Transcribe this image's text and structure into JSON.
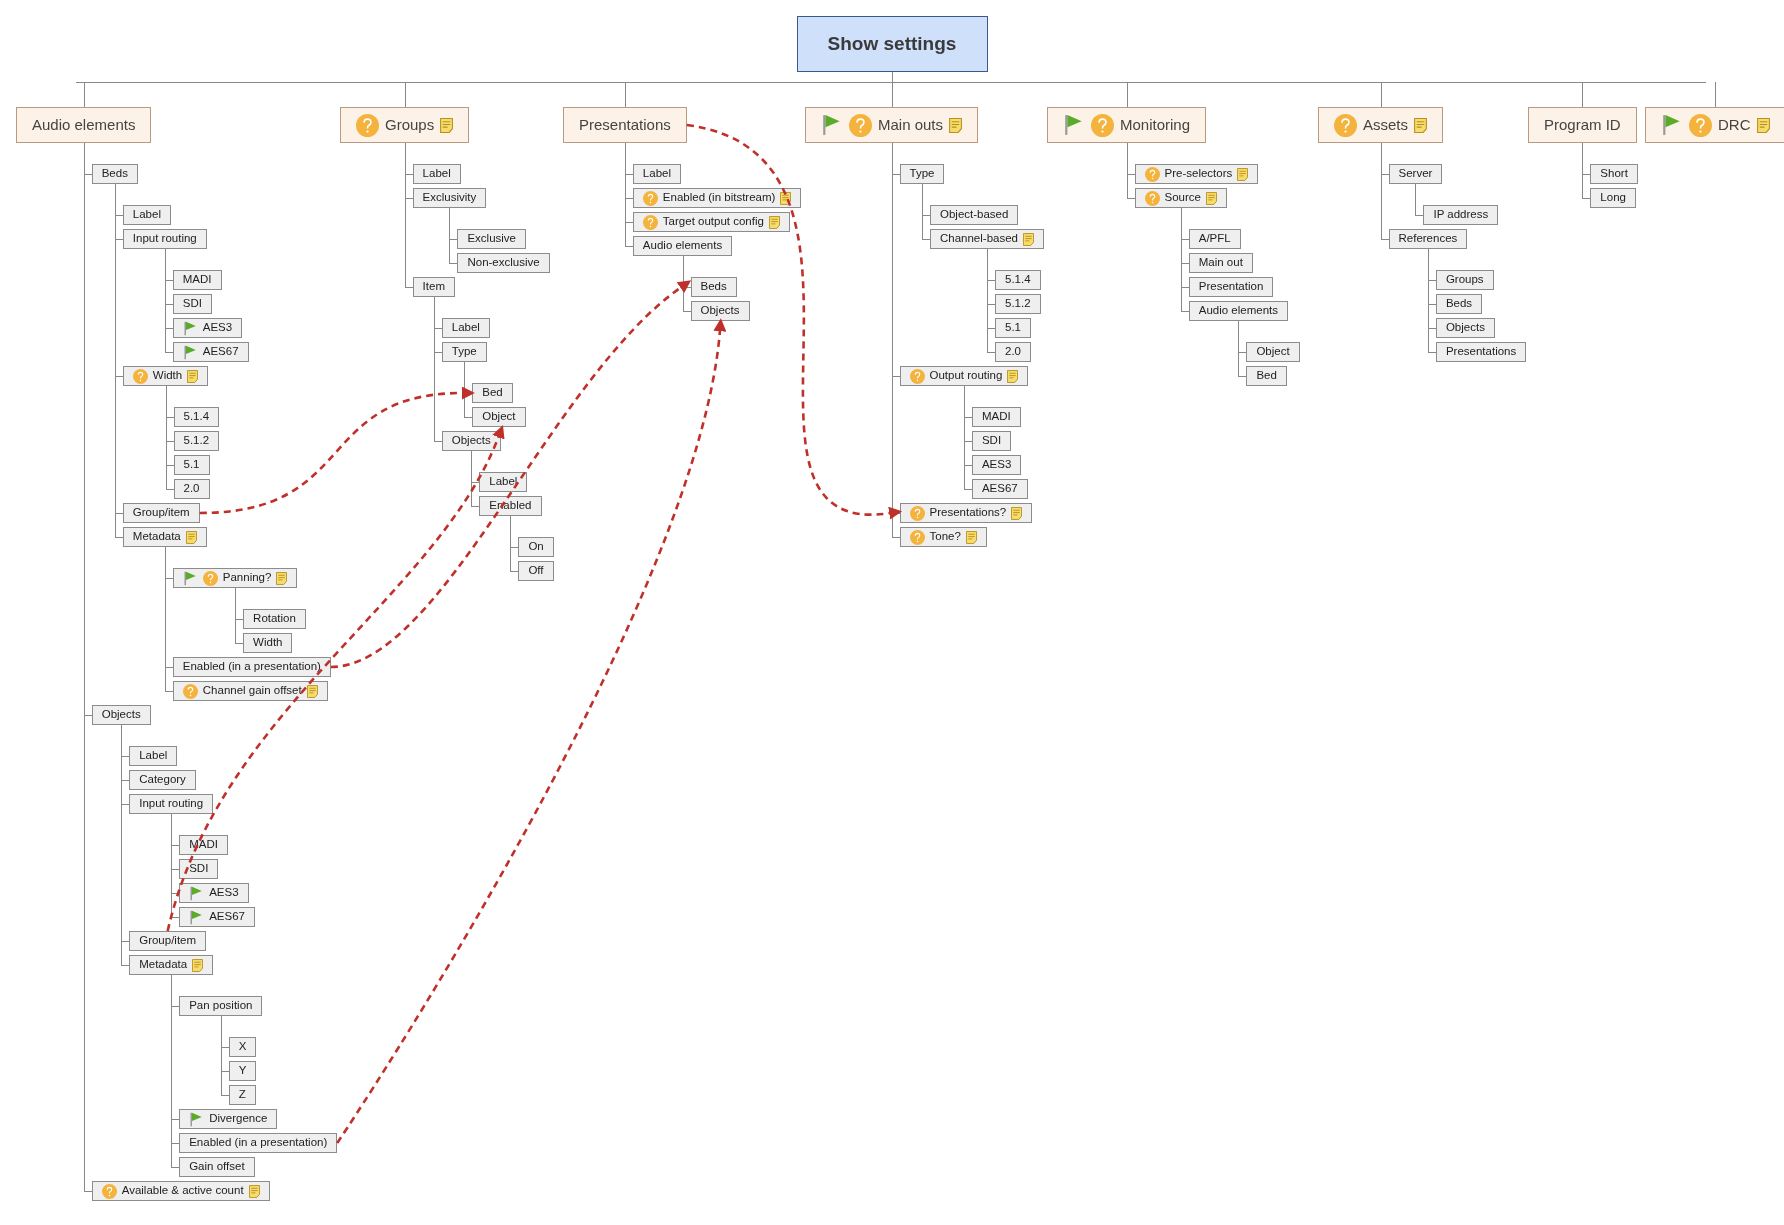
{
  "root": {
    "label": "Show settings"
  },
  "topics": [
    {
      "label": "Audio elements",
      "children": [
        {
          "label": "Beds",
          "children": [
            {
              "label": "Label"
            },
            {
              "label": "Input routing",
              "children": [
                {
                  "label": "MADI"
                },
                {
                  "label": "SDI"
                },
                {
                  "label": "AES3",
                  "flag": true
                },
                {
                  "label": "AES67",
                  "flag": true
                }
              ]
            },
            {
              "label": "Width",
              "question": true,
              "note": true,
              "children": [
                {
                  "label": "5.1.4"
                },
                {
                  "label": "5.1.2"
                },
                {
                  "label": "5.1"
                },
                {
                  "label": "2.0"
                }
              ]
            },
            {
              "label": "Group/item"
            },
            {
              "label": "Metadata",
              "note": true,
              "children": [
                {
                  "label": "Panning?",
                  "flag": true,
                  "question": true,
                  "note": true,
                  "children": [
                    {
                      "label": "Rotation"
                    },
                    {
                      "label": "Width"
                    }
                  ]
                },
                {
                  "label": "Enabled (in a presentation)"
                },
                {
                  "label": "Channel gain offset",
                  "question": true,
                  "note": true
                }
              ]
            }
          ]
        },
        {
          "label": "Objects",
          "children": [
            {
              "label": "Label"
            },
            {
              "label": "Category"
            },
            {
              "label": "Input routing",
              "children": [
                {
                  "label": "MADI"
                },
                {
                  "label": "SDI"
                },
                {
                  "label": "AES3",
                  "flag": true
                },
                {
                  "label": "AES67",
                  "flag": true
                }
              ]
            },
            {
              "label": "Group/item"
            },
            {
              "label": "Metadata",
              "note": true,
              "children": [
                {
                  "label": "Pan position",
                  "children": [
                    {
                      "label": "X"
                    },
                    {
                      "label": "Y"
                    },
                    {
                      "label": "Z"
                    }
                  ]
                },
                {
                  "label": "Divergence",
                  "flag": true
                },
                {
                  "label": "Enabled (in a presentation)"
                },
                {
                  "label": "Gain offset"
                }
              ]
            }
          ]
        },
        {
          "label": "Available & active count",
          "question": true,
          "note": true
        }
      ]
    },
    {
      "label": "Groups",
      "question": true,
      "note": true,
      "children": [
        {
          "label": "Label"
        },
        {
          "label": "Exclusivity",
          "children": [
            {
              "label": "Exclusive"
            },
            {
              "label": "Non-exclusive"
            }
          ]
        },
        {
          "label": "Item",
          "children": [
            {
              "label": "Label"
            },
            {
              "label": "Type",
              "children": [
                {
                  "label": "Bed"
                },
                {
                  "label": "Object"
                }
              ]
            },
            {
              "label": "Objects",
              "children": [
                {
                  "label": "Label"
                },
                {
                  "label": "Enabled",
                  "children": [
                    {
                      "label": "On"
                    },
                    {
                      "label": "Off"
                    }
                  ]
                }
              ]
            }
          ]
        }
      ]
    },
    {
      "label": "Presentations",
      "children": [
        {
          "label": "Label"
        },
        {
          "label": "Enabled (in bitstream)",
          "question": true,
          "note": true
        },
        {
          "label": "Target output config",
          "question": true,
          "note": true
        },
        {
          "label": "Audio elements",
          "children": [
            {
              "label": "Beds"
            },
            {
              "label": "Objects"
            }
          ]
        }
      ]
    },
    {
      "label": "Main outs",
      "flag": true,
      "question": true,
      "note": true,
      "children": [
        {
          "label": "Type",
          "children": [
            {
              "label": "Object-based"
            },
            {
              "label": "Channel-based",
              "note": true,
              "children": [
                {
                  "label": "5.1.4"
                },
                {
                  "label": "5.1.2"
                },
                {
                  "label": "5.1"
                },
                {
                  "label": "2.0"
                }
              ]
            }
          ]
        },
        {
          "label": "Output routing",
          "question": true,
          "note": true,
          "children": [
            {
              "label": "MADI"
            },
            {
              "label": "SDI"
            },
            {
              "label": "AES3"
            },
            {
              "label": "AES67"
            }
          ]
        },
        {
          "label": "Presentations?",
          "question": true,
          "note": true
        },
        {
          "label": "Tone?",
          "question": true,
          "note": true
        }
      ]
    },
    {
      "label": "Monitoring",
      "flag": true,
      "question": true,
      "children": [
        {
          "label": "Pre-selectors",
          "question": true,
          "note": true
        },
        {
          "label": "Source",
          "question": true,
          "note": true,
          "children": [
            {
              "label": "A/PFL"
            },
            {
              "label": "Main out"
            },
            {
              "label": "Presentation"
            },
            {
              "label": "Audio elements",
              "children": [
                {
                  "label": "Object"
                },
                {
                  "label": "Bed"
                }
              ]
            }
          ]
        }
      ]
    },
    {
      "label": "Assets",
      "question": true,
      "note": true,
      "children": [
        {
          "label": "Server",
          "children": [
            {
              "label": "IP address"
            }
          ]
        },
        {
          "label": "References",
          "children": [
            {
              "label": "Groups"
            },
            {
              "label": "Beds"
            },
            {
              "label": "Objects"
            },
            {
              "label": "Presentations"
            }
          ]
        }
      ]
    },
    {
      "label": "Program ID",
      "children": [
        {
          "label": "Short"
        },
        {
          "label": "Long"
        }
      ]
    },
    {
      "label": "DRC",
      "flag": true,
      "question": true,
      "note": true
    }
  ]
}
